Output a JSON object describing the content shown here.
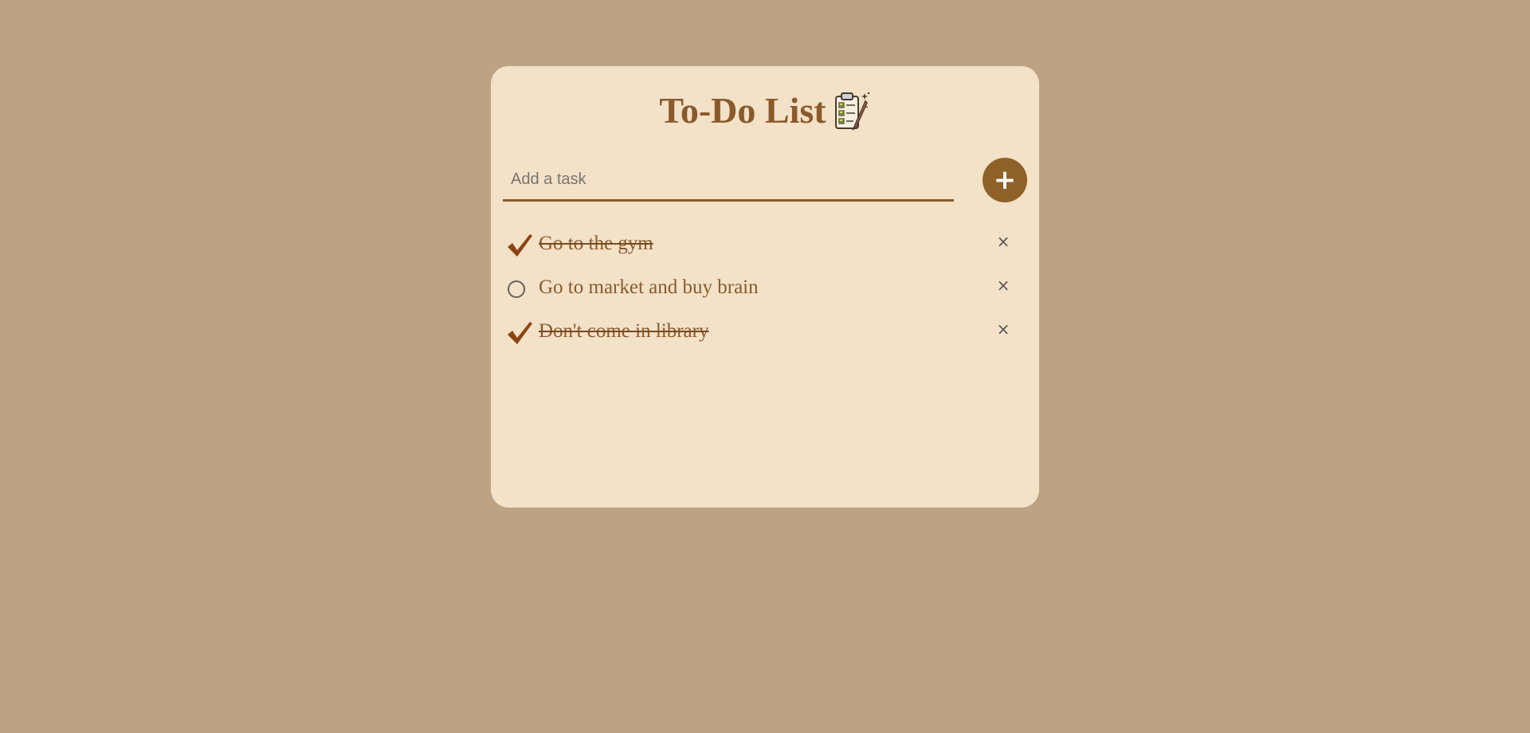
{
  "app": {
    "title": "To-Do List",
    "title_icon": "clipboard-checklist-icon"
  },
  "input": {
    "placeholder": "Add a task",
    "value": ""
  },
  "add_button": {
    "label": "+"
  },
  "tasks": [
    {
      "text": "Go to the gym",
      "completed": true,
      "delete_label": "×"
    },
    {
      "text": "Go to market and buy brain",
      "completed": false,
      "delete_label": "×"
    },
    {
      "text": "Don't come in library",
      "completed": true,
      "delete_label": "×"
    }
  ],
  "colors": {
    "background": "#bba384",
    "card": "#f3e1c8",
    "accent": "#8e6128",
    "title_text": "#8a5a2b",
    "check": "#8b4513"
  }
}
